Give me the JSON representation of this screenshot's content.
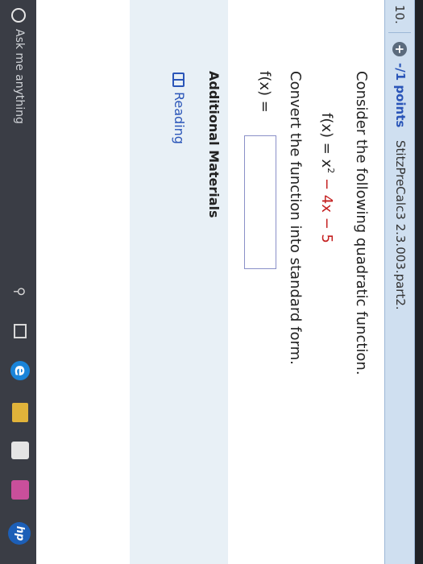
{
  "question": {
    "number": "10.",
    "points_label": "-/1 points",
    "problem_id": "StitzPreCalc3 2.3.003.part2.",
    "prompt_consider": "Consider the following quadratic function.",
    "function": {
      "lhs": "f(x) = x",
      "exponent": "2",
      "rest": " − 4x − 5"
    },
    "prompt_convert": "Convert the function into standard form.",
    "answer_label": "f(x) =",
    "answer_value": ""
  },
  "additional_materials": {
    "title": "Additional Materials",
    "reading_label": "Reading"
  },
  "taskbar": {
    "search_placeholder": "Ask me anything",
    "pinned_icons": [
      "mic-icon",
      "task-view-icon",
      "edge-icon",
      "file-explorer-icon",
      "store-icon",
      "photos-icon",
      "hp-icon"
    ],
    "edge_glyph": "e",
    "hp_glyph": "hp"
  },
  "colors": {
    "header_bg": "#cfdff0",
    "points_link": "#2a55b8",
    "function_red": "#c41f1f",
    "additional_bg": "#e8f0f6",
    "taskbar_bg": "#3a3d45"
  }
}
